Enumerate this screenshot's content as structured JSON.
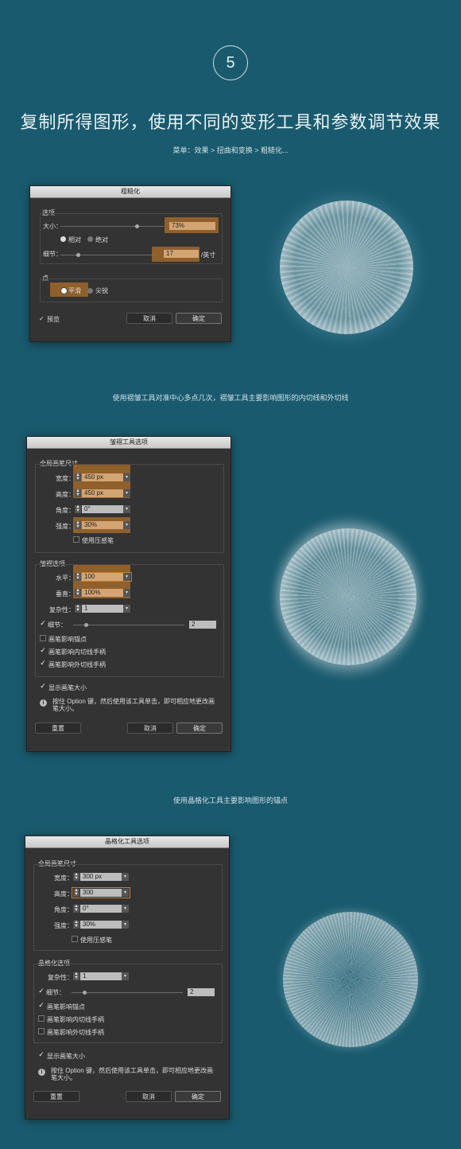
{
  "step_number": "5",
  "headline": "复制所得图形，使用不同的变形工具和参数调节效果",
  "menu_path": "菜单：效果 > 扭曲和变换 > 粗糙化...",
  "caption_pucker": "使用褶皱工具对准中心多点几次，褶皱工具主要影响图形的内切线和外切线",
  "caption_crystallize": "使用晶格化工具主要影响图形的锚点",
  "roughen": {
    "title": "粗糙化",
    "options_label": "选项",
    "size_label": "大小：",
    "size_value": "73%",
    "size_level": 0.73,
    "relative_label": "相对",
    "absolute_label": "绝对",
    "detail_label": "细节：",
    "detail_value": "17",
    "detail_unit": "/英寸",
    "points_label": "点",
    "smooth_label": "平滑",
    "corner_label": "尖锐",
    "preview_label": "预览",
    "cancel": "取消",
    "ok": "确定"
  },
  "pucker": {
    "title": "皱褶工具选项",
    "global_brush": "全局画笔尺寸",
    "width_label": "宽度：",
    "width_value": "450 px",
    "height_label": "高度：",
    "height_value": "450 px",
    "angle_label": "角度：",
    "angle_value": "0°",
    "intensity_label": "强度：",
    "intensity_value": "30%",
    "pressure_pen": "使用压感笔",
    "pucker_options": "皱褶选项",
    "horizontal_label": "水平：",
    "horizontal_value": "100",
    "vertical_label": "垂直：",
    "vertical_value": "100%",
    "complexity_label": "复杂性：",
    "complexity_value": "1",
    "detail_label": "细节：",
    "detail_value": "2",
    "affect_anchor": "画笔影响锚点",
    "affect_in": "画笔影响内切线手柄",
    "affect_out": "画笔影响外切线手柄",
    "show_brush": "显示画笔大小",
    "info_text": "按住 Option 键，然后使用该工具单击，即可相应地更改画笔大小。",
    "reset": "重置",
    "cancel": "取消",
    "ok": "确定"
  },
  "crystallize": {
    "title": "晶格化工具选项",
    "global_brush": "全局画笔尺寸",
    "width_label": "宽度：",
    "width_value": "300 px",
    "height_label": "高度：",
    "height_value": "300",
    "angle_label": "角度：",
    "angle_value": "0°",
    "intensity_label": "强度：",
    "intensity_value": "30%",
    "pressure_pen": "使用压感笔",
    "crystal_options": "晶格化选项",
    "complexity_label": "复杂性：",
    "complexity_value": "1",
    "detail_label": "细节：",
    "detail_value": "2",
    "affect_anchor": "画笔影响锚点",
    "affect_in": "画笔影响内切线手柄",
    "affect_out": "画笔影响外切线手柄",
    "show_brush": "显示画笔大小",
    "info_text": "按住 Option 键，然后使用该工具单击，即可相应地更改画笔大小。",
    "reset": "重置",
    "cancel": "取消",
    "ok": "确定"
  },
  "colors": {
    "background": "#1a5a6e",
    "dialog": "#333333",
    "highlight": "#a0672c"
  }
}
